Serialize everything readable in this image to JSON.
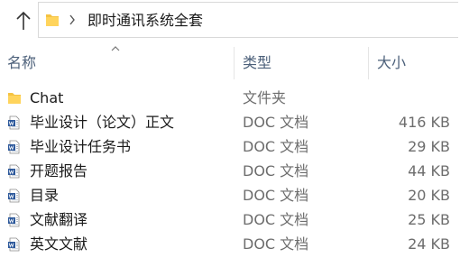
{
  "address_bar": {
    "breadcrumb": "即时通讯系统全套"
  },
  "columns": {
    "name": "名称",
    "type": "类型",
    "size": "大小"
  },
  "files": [
    {
      "name": "Chat",
      "type": "文件夹",
      "size": "",
      "icon": "folder-icon"
    },
    {
      "name": "毕业设计（论文）正文",
      "type": "DOC 文档",
      "size": "416 KB",
      "icon": "doc-file-icon"
    },
    {
      "name": "毕业设计任务书",
      "type": "DOC 文档",
      "size": "29 KB",
      "icon": "doc-file-icon"
    },
    {
      "name": "开题报告",
      "type": "DOC 文档",
      "size": "44 KB",
      "icon": "doc-file-icon"
    },
    {
      "name": "目录",
      "type": "DOC 文档",
      "size": "20 KB",
      "icon": "doc-file-icon"
    },
    {
      "name": "文献翻译",
      "type": "DOC 文档",
      "size": "25 KB",
      "icon": "doc-file-icon"
    },
    {
      "name": "英文文献",
      "type": "DOC 文档",
      "size": "24 KB",
      "icon": "doc-file-icon"
    }
  ],
  "colors": {
    "header_text": "#4c607a",
    "folder_yellow": "#f5c342",
    "doc_blue": "#2b579a"
  }
}
